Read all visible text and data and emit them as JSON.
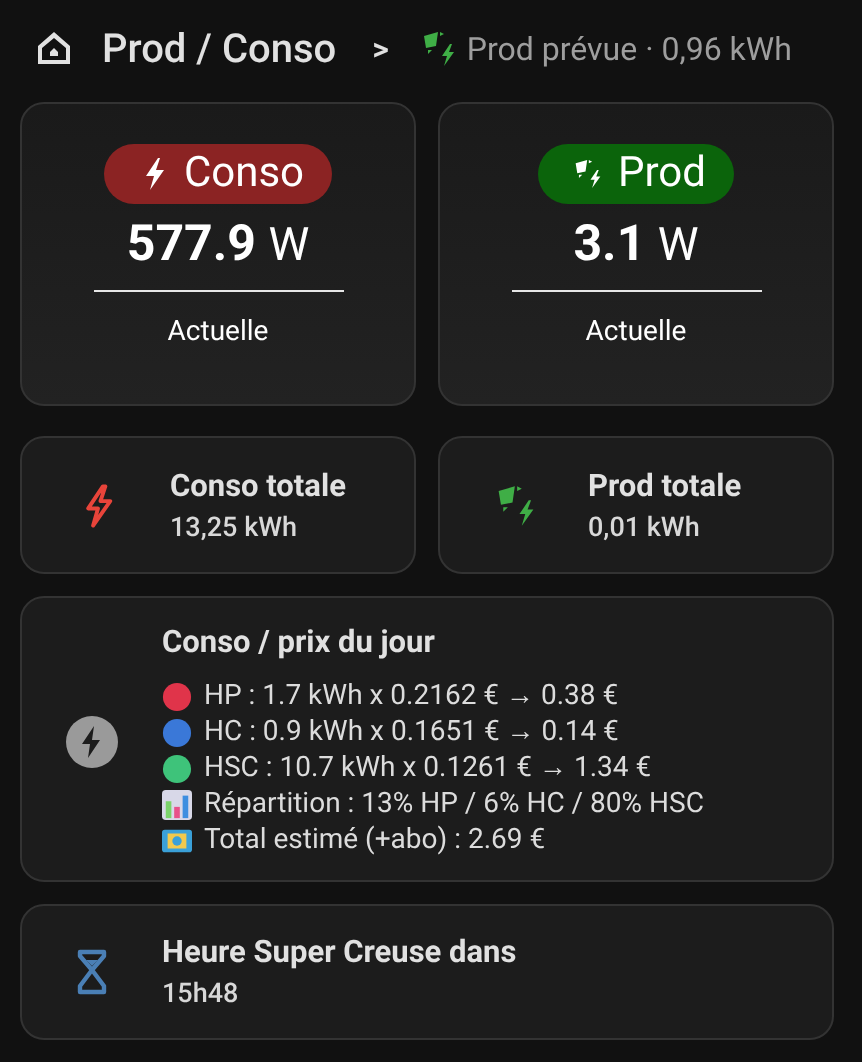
{
  "header": {
    "title": "Prod / Conso",
    "separator": ">",
    "forecast": "Prod prévue · 0,96 kWh"
  },
  "gauges": [
    {
      "kind": "conso",
      "badge": "Conso",
      "value": "577.9",
      "unit": "W",
      "label": "Actuelle",
      "color": "#8b2323"
    },
    {
      "kind": "prod",
      "badge": "Prod",
      "value": "3.1",
      "unit": "W",
      "label": "Actuelle",
      "color": "#0b640b"
    }
  ],
  "totals": [
    {
      "kind": "conso",
      "title": "Conso totale",
      "value": "13,25 kWh"
    },
    {
      "kind": "prod",
      "title": "Prod totale",
      "value": "0,01 kWh"
    }
  ],
  "price_card": {
    "title": "Conso / prix du jour",
    "lines": [
      {
        "kind": "dot",
        "color": "#e0344a",
        "text": "HP : 1.7 kWh x 0.2162 € → 0.38 €"
      },
      {
        "kind": "dot",
        "color": "#3a78d8",
        "text": "HC : 0.9 kWh x 0.1651 € → 0.14 €"
      },
      {
        "kind": "dot",
        "color": "#3ec37a",
        "text": "HSC : 10.7 kWh x 0.1261 € → 1.34 €"
      },
      {
        "kind": "chart",
        "text": "Répartition : 13% HP / 6% HC / 80% HSC"
      },
      {
        "kind": "money",
        "text": "Total estimé (+abo) : 2.69 €"
      }
    ]
  },
  "countdown": {
    "title": "Heure Super Creuse dans",
    "value": "15h48"
  }
}
